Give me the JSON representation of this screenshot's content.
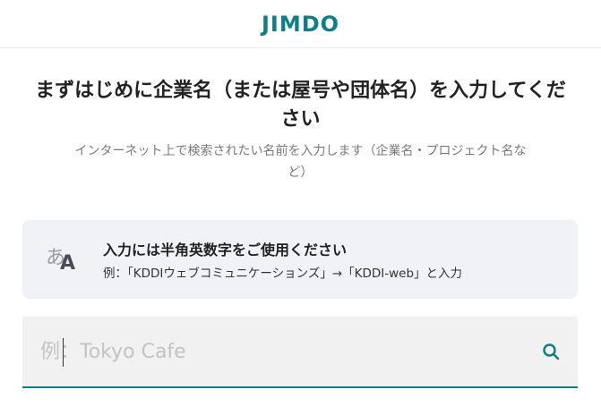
{
  "header": {
    "logo_text": "JIMDO"
  },
  "main": {
    "title": "まずはじめに企業名（または屋号や団体名）を入力してください",
    "subtitle": "インターネット上で検索されたい名前を入力します（企業名・プロジェクト名など）"
  },
  "notice": {
    "icon_glyph_a": "あ",
    "icon_glyph_b": "A",
    "title": "入力には半角英数字をご使用ください",
    "example": "例：「KDDIウェブコミュニケーションズ」→「KDDI-web」と入力"
  },
  "search": {
    "placeholder": "例：Tokyo Cafe",
    "value": ""
  },
  "colors": {
    "accent": "#0e7f86",
    "notice_bg": "#f1f2f6",
    "input_bg": "#f1f1f1"
  }
}
